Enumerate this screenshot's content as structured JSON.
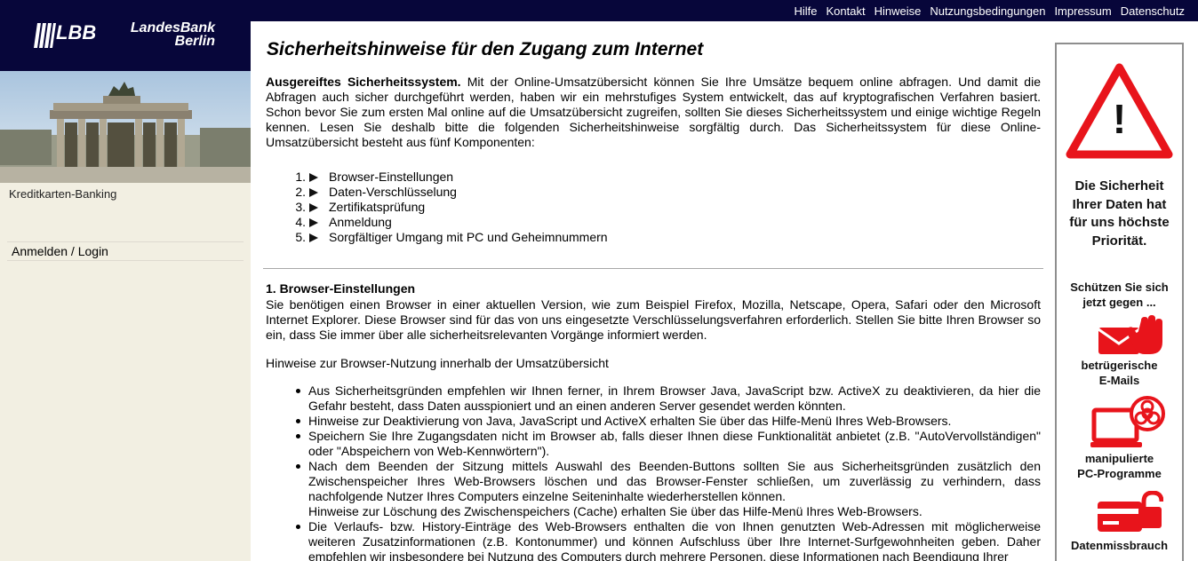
{
  "topnav": {
    "items": [
      "Hilfe",
      "Kontakt",
      "Hinweise",
      "Nutzungsbedingungen",
      "Impressum",
      "Datenschutz"
    ]
  },
  "logo": {
    "mark_text": "LBB",
    "bank_line1": "LandesBank",
    "bank_line2": "Berlin"
  },
  "sidebar": {
    "section_label": "Kreditkarten-Banking",
    "login_link": "Anmelden / Login"
  },
  "main": {
    "title": "Sicherheitshinweise für den Zugang zum Internet",
    "intro_bold": "Ausgereiftes Sicherheitssystem.",
    "intro_text": " Mit der Online-Umsatzübersicht können Sie Ihre Umsätze bequem online abfragen. Und damit die Abfragen auch sicher durchgeführt werden, haben wir ein mehrstufiges System entwickelt, das auf kryptografischen Verfahren basiert. Schon bevor Sie zum ersten Mal online auf die Umsatzübersicht zugreifen, sollten Sie dieses Sicherheitssystem und einige wichtige Regeln kennen. Lesen Sie deshalb bitte die folgenden Sicherheitshinweise sorgfältig durch. Das Sicherheitssystem für diese Online-Umsatzübersicht besteht aus fünf Komponenten:",
    "toc": [
      {
        "num": "1.",
        "label": "Browser-Einstellungen"
      },
      {
        "num": "2.",
        "label": "Daten-Verschlüsselung"
      },
      {
        "num": "3.",
        "label": "Zertifikatsprüfung"
      },
      {
        "num": "4.",
        "label": "Anmeldung"
      },
      {
        "num": "5.",
        "label": "Sorgfältiger Umgang mit PC und Geheimnummern"
      }
    ],
    "section1_title": "1. Browser-Einstellungen",
    "section1_text": "Sie benötigen einen Browser in einer aktuellen Version, wie zum Beispiel Firefox, Mozilla, Netscape, Opera, Safari oder den Microsoft Internet Explorer. Diese Browser sind für das von uns eingesetzte Verschlüsselungsverfahren erforderlich. Stellen Sie bitte Ihren Browser so ein, dass Sie immer über alle sicherheitsrelevanten Vorgänge informiert werden.",
    "section1_hint": "Hinweise zur Browser-Nutzung innerhalb der Umsatzübersicht",
    "bullets": [
      "Aus Sicherheitsgründen empfehlen wir Ihnen ferner, in Ihrem Browser Java, JavaScript bzw. ActiveX zu deaktivieren, da hier die Gefahr besteht, dass Daten ausspioniert und an einen anderen Server gesendet werden könnten.",
      "Hinweise zur Deaktivierung von Java, JavaScript und ActiveX erhalten Sie über das Hilfe-Menü Ihres Web-Browsers.",
      "Speichern Sie Ihre Zugangsdaten nicht im Browser ab, falls dieser Ihnen diese Funktionalität anbietet (z.B. \"AutoVervollständigen\" oder \"Abspeichern von Web-Kennwörtern\").",
      "Nach dem Beenden der Sitzung mittels Auswahl des Beenden-Buttons sollten Sie aus Sicherheitsgründen zusätzlich den Zwischenspeicher Ihres Web-Browsers löschen und das Browser-Fenster schließen, um zuverlässig zu verhindern, dass nachfolgende Nutzer Ihres Computers einzelne Seiteninhalte wiederherstellen können.",
      "Die Verlaufs- bzw. History-Einträge des Web-Browsers enthalten die von Ihnen genutzten Web-Adressen mit möglicherweise weiteren Zusatzinformationen (z.B. Kontonummer) und können Aufschluss über Ihre Internet-Surfgewohnheiten geben. Daher empfehlen wir insbesondere bei Nutzung des Computers durch mehrere Personen, diese Informationen nach Beendigung Ihrer"
    ],
    "bullet4_sub": "Hinweise zur Löschung des Zwischenspeichers (Cache) erhalten Sie über das Hilfe-Menü Ihres Web-Browsers."
  },
  "security_panel": {
    "warning_glyph": "!",
    "headline_lines": [
      "Die Sicherheit",
      "Ihrer Daten hat",
      "für uns höchste",
      "Priorität."
    ],
    "protect_lines": [
      "Schützen Sie sich",
      "jetzt gegen ..."
    ],
    "threats": [
      {
        "icon": "phishing-email-icon",
        "lines": [
          "betrügerische",
          "E-Mails"
        ]
      },
      {
        "icon": "malware-pc-icon",
        "lines": [
          "manipulierte",
          "PC-Programme"
        ]
      },
      {
        "icon": "card-fraud-icon",
        "lines": [
          "Datenmissbrauch"
        ]
      }
    ],
    "accent_color": "#e8141b"
  }
}
